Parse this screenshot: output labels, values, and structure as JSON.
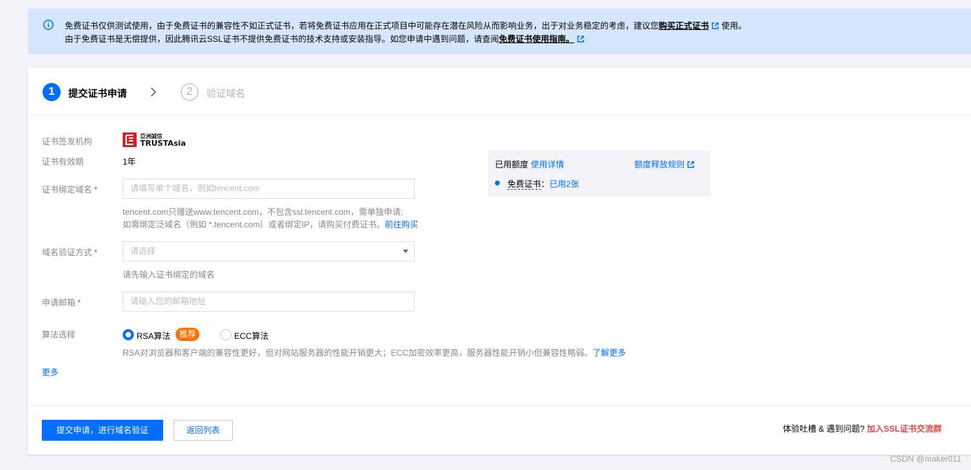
{
  "notice": {
    "line1_prefix": "免费证书仅供测试使用，由于免费证书的兼容性不如正式证书，若将免费证书应用在正式项目中可能存在潜在风险从而影响业务，出于对业务稳定的考虑，建议您",
    "line1_link": "购买正式证书",
    "line1_suffix": "使用。",
    "line2_prefix": "由于免费证书是无偿提供，因此腾讯云SSL证书不提供免费证书的技术支持或安装指导。如您申请中遇到问题，请查阅",
    "line2_link": "免费证书使用指南。"
  },
  "steps": [
    {
      "number": "1",
      "label": "提交证书申请"
    },
    {
      "number": "2",
      "label": "验证域名"
    }
  ],
  "form": {
    "issuer_label": "证书签发机构",
    "issuer_logo_text_top": "亞洲誠信",
    "issuer_logo_text": "TRUSTAsia",
    "validity_label": "证书有效期",
    "validity_value": "1年",
    "domain_label": "证书绑定域名",
    "domain_placeholder": "请填写单个域名，例如tencent.com",
    "domain_hint1": "tencent.com只赠送www.tencent.com，不包含ssl.tencent.com，需单独申请;",
    "domain_hint2_prefix": "如需绑定泛域名（例如 *.tencent.com）或者绑定IP，请购买付费证书。",
    "domain_hint2_link": "前往购买",
    "verify_label": "域名验证方式",
    "verify_placeholder": "请选择",
    "verify_hint": "请先输入证书绑定的域名",
    "email_label": "申请邮箱",
    "email_placeholder": "请输入您的邮箱地址",
    "algo_label": "算法选择",
    "algo_rsa": "RSA算法",
    "algo_badge": "推荐",
    "algo_ecc": "ECC算法",
    "algo_hint": "RSA对浏览器和客户端的兼容性更好，但对网站服务器的性能开销更大；ECC加密效率更高，服务器性能开销小但兼容性略弱。",
    "algo_hint_link": "了解更多",
    "required_mark": "*",
    "more_label": "更多"
  },
  "quota": {
    "title": "已用额度",
    "detail_link": "使用详情",
    "rule_link": "额度释放规则",
    "item_name": "免费证书",
    "item_sep": "：",
    "item_value": "已用2张"
  },
  "footer": {
    "submit_label": "提交申请，进行域名验证",
    "back_label": "返回列表",
    "feedback_prefix": "体验吐槽 & 遇到问题?",
    "feedback_link": "加入SSL证书交流群"
  },
  "watermark": "CSDN @maker011",
  "colors": {
    "primary": "#006eff",
    "notice_bg": "#d5e7fe",
    "badge": "#ff7200",
    "danger": "#e54545"
  }
}
